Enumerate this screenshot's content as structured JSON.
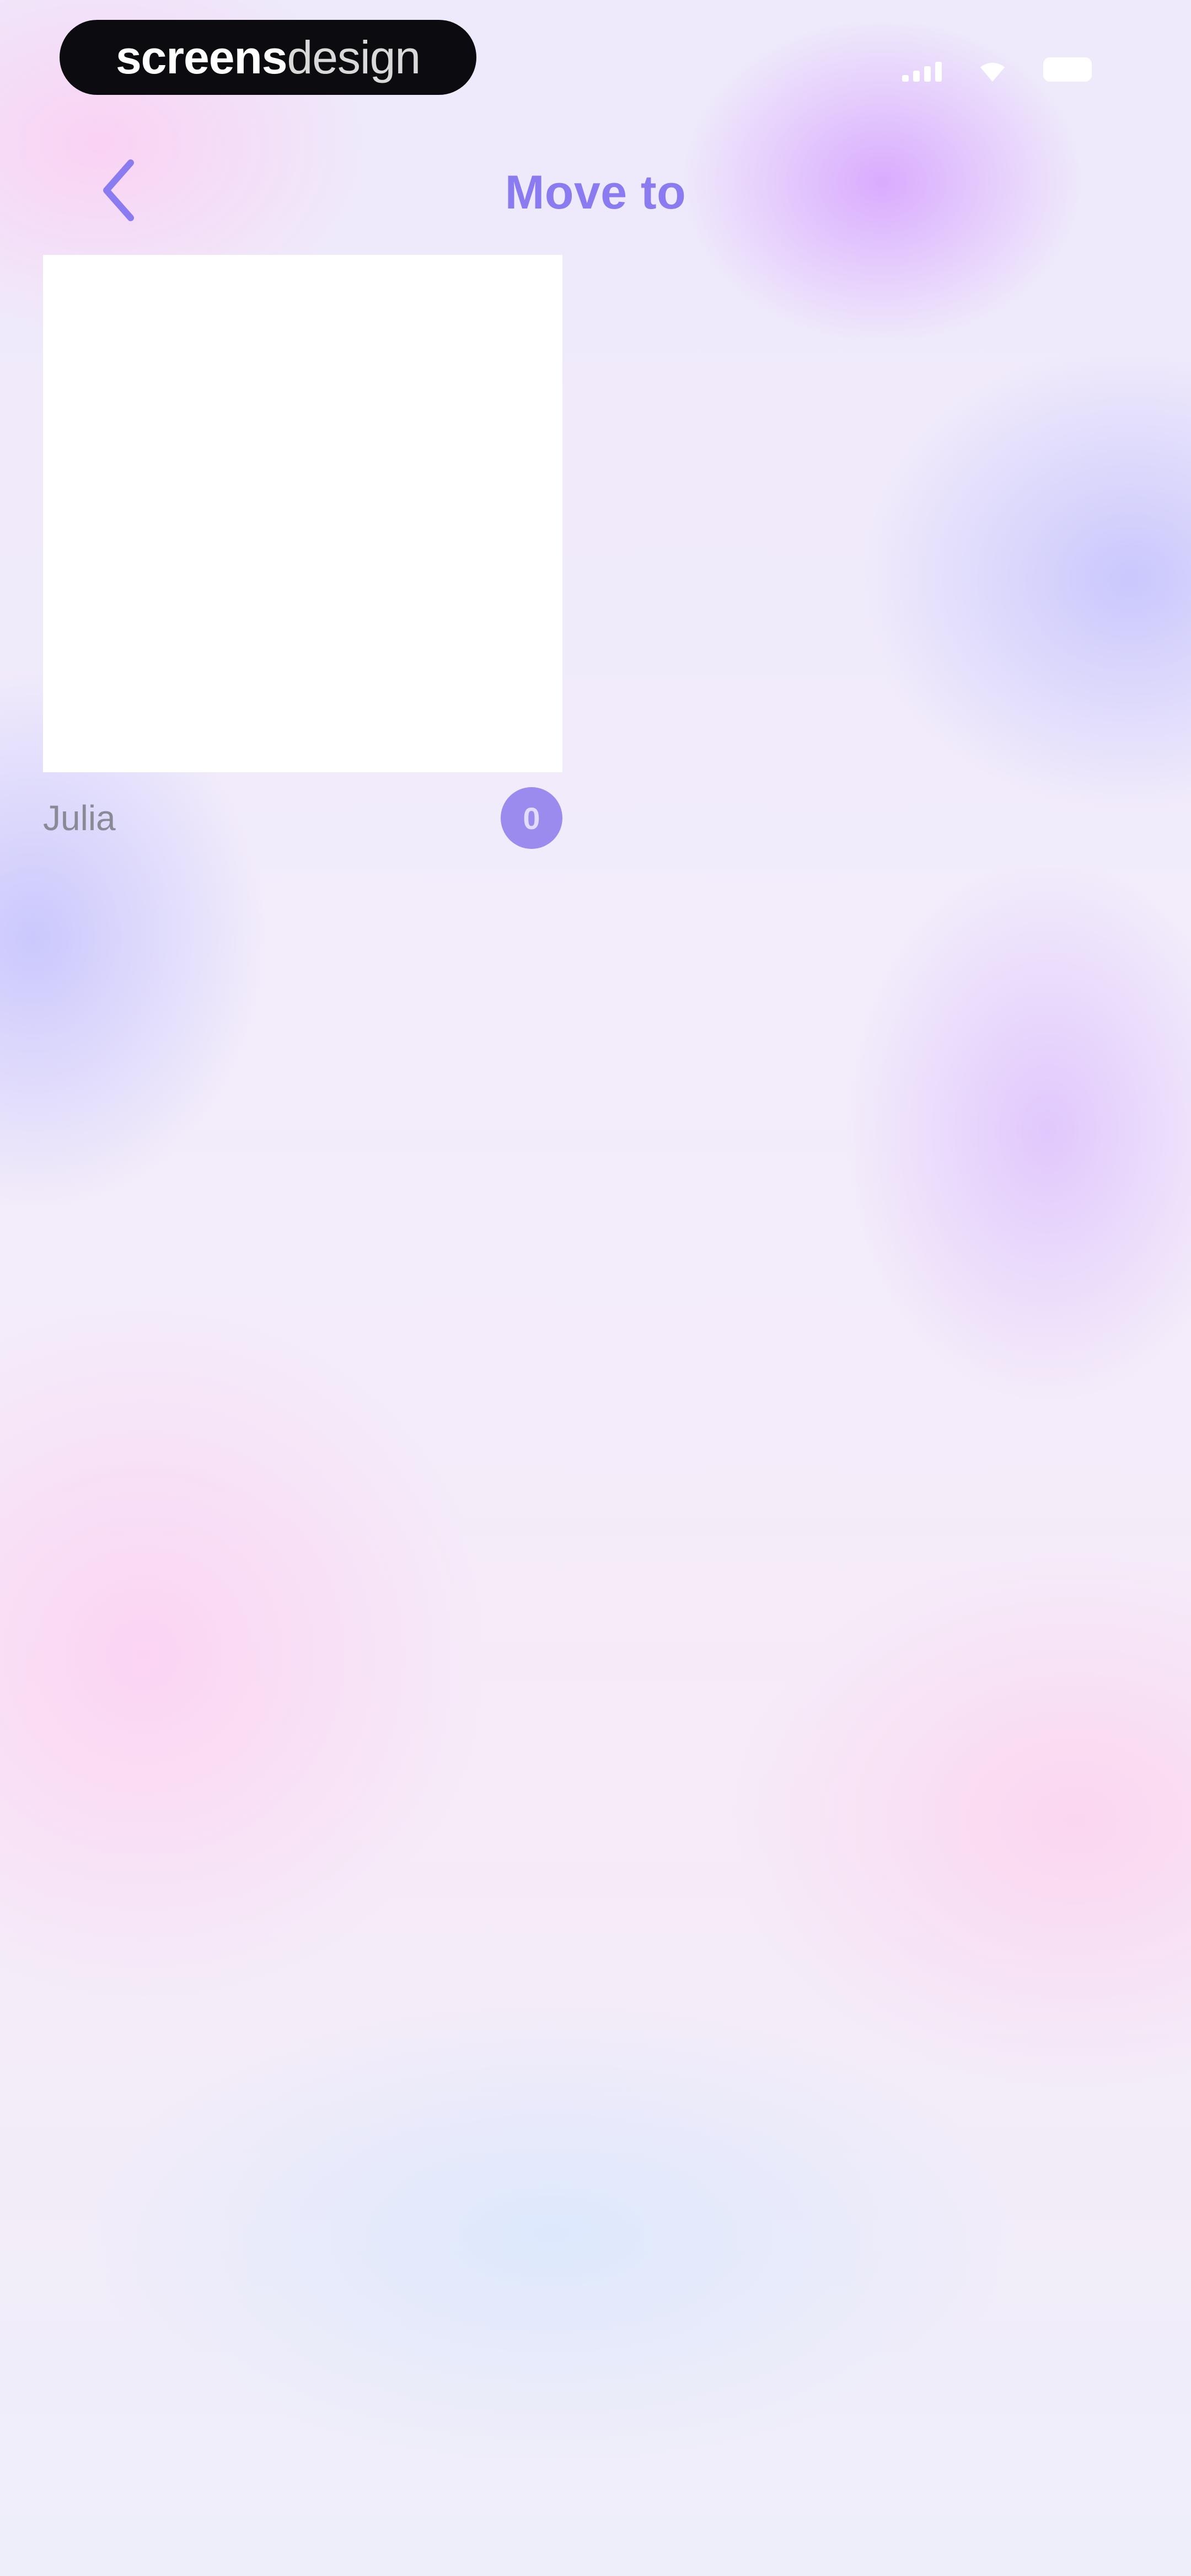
{
  "status_bar": {
    "logo_bold": "screens",
    "logo_light": "design",
    "icons": [
      "signal-icon",
      "wifi-icon",
      "battery-icon"
    ]
  },
  "nav": {
    "back_icon": "chevron-left-icon",
    "title": "Move to"
  },
  "folders": [
    {
      "name": "Julia",
      "count": "0"
    }
  ],
  "colors": {
    "accent": "#8a7cf0",
    "badge": "#9b8bef",
    "card": "#ffffff"
  }
}
